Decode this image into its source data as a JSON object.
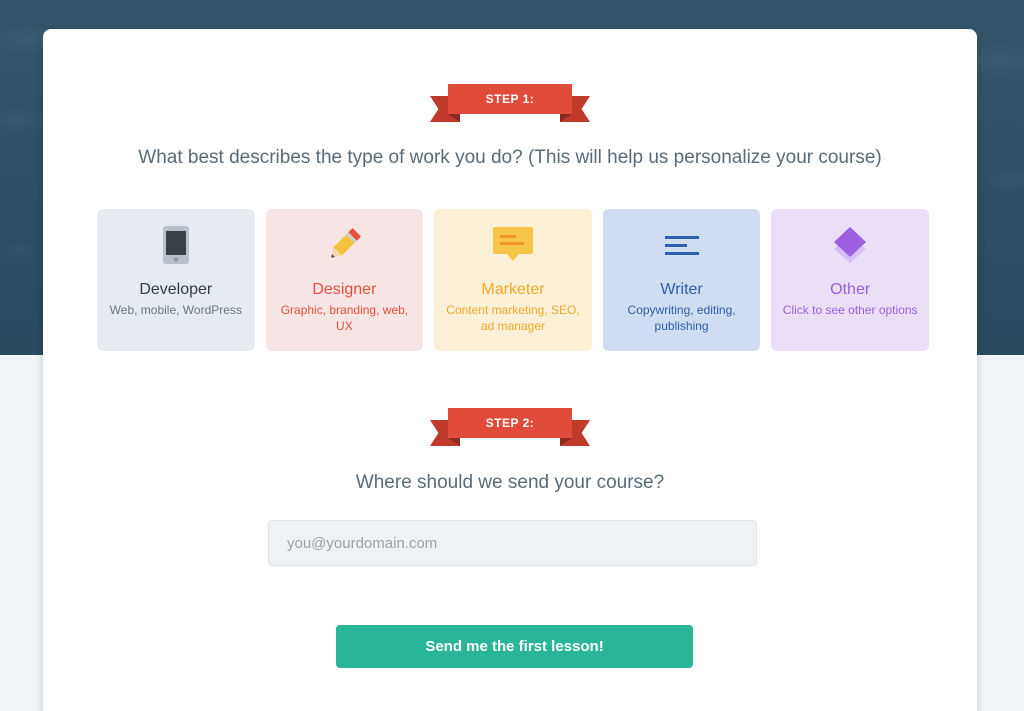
{
  "step1": {
    "ribbon_label": "STEP 1:",
    "question": "What best describes the type of work you do? (This will help us personalize your course)"
  },
  "options": [
    {
      "title": "Developer",
      "description": "Web, mobile, WordPress",
      "icon": "tablet-icon"
    },
    {
      "title": "Designer",
      "description": "Graphic, branding, web, UX",
      "icon": "pencil-icon"
    },
    {
      "title": "Marketer",
      "description": "Content marketing, SEO, ad manager",
      "icon": "speech-bubble-icon"
    },
    {
      "title": "Writer",
      "description": "Copywriting, editing, publishing",
      "icon": "text-lines-icon"
    },
    {
      "title": "Other",
      "description": "Click to see other options",
      "icon": "layers-icon"
    }
  ],
  "step2": {
    "ribbon_label": "STEP 2:",
    "question": "Where should we send your course?"
  },
  "email_field": {
    "value": "",
    "placeholder": "you@yourdomain.com"
  },
  "submit_button": {
    "label": "Send me the first lesson!"
  },
  "colors": {
    "ribbon": "#e04b3a",
    "button": "#2ab498",
    "developer": "#e5ebf0",
    "designer": "#f7e4e4",
    "marketer": "#fbefd6",
    "writer": "#cfdcf1",
    "other": "#ebdff8"
  }
}
